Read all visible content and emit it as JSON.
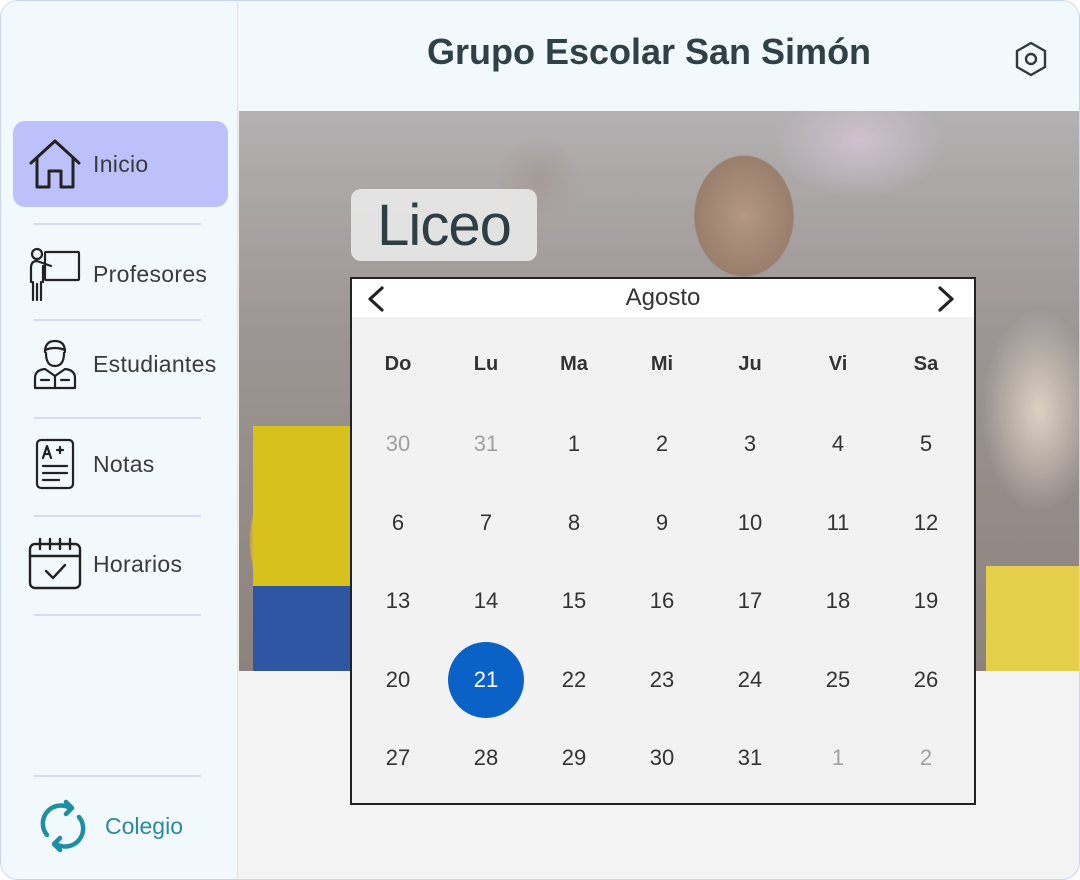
{
  "header": {
    "title": "Grupo Escolar San Simón"
  },
  "sidebar": {
    "items": [
      {
        "label": "Inicio",
        "icon": "home-icon",
        "active": true
      },
      {
        "label": "Profesores",
        "icon": "teacher-icon",
        "active": false
      },
      {
        "label": "Estudiantes",
        "icon": "student-icon",
        "active": false
      },
      {
        "label": "Notas",
        "icon": "grades-icon",
        "active": false
      },
      {
        "label": "Horarios",
        "icon": "calendar-check-icon",
        "active": false
      }
    ],
    "bottom": {
      "label": "Colegio",
      "icon": "switch-refresh-icon"
    }
  },
  "hero": {
    "badge": "Liceo"
  },
  "calendar": {
    "month": "Agosto",
    "weekdays": [
      "Do",
      "Lu",
      "Ma",
      "Mi",
      "Ju",
      "Vi",
      "Sa"
    ],
    "weeks": [
      [
        "30",
        "31",
        "1",
        "2",
        "3",
        "4",
        "5"
      ],
      [
        "6",
        "7",
        "8",
        "9",
        "10",
        "11",
        "12"
      ],
      [
        "13",
        "14",
        "15",
        "16",
        "17",
        "18",
        "19"
      ],
      [
        "20",
        "21",
        "22",
        "23",
        "24",
        "25",
        "26"
      ],
      [
        "27",
        "28",
        "29",
        "30",
        "31",
        "1",
        "2"
      ]
    ],
    "other_month": [
      [
        0,
        0
      ],
      [
        0,
        1
      ],
      [
        4,
        5
      ],
      [
        4,
        6
      ]
    ],
    "selected": [
      3,
      1
    ]
  },
  "colors": {
    "active_nav": "#bcc1fb",
    "selected_day": "#0a62c6",
    "accent_teal": "#2a8b9a",
    "title": "#2f4046"
  }
}
